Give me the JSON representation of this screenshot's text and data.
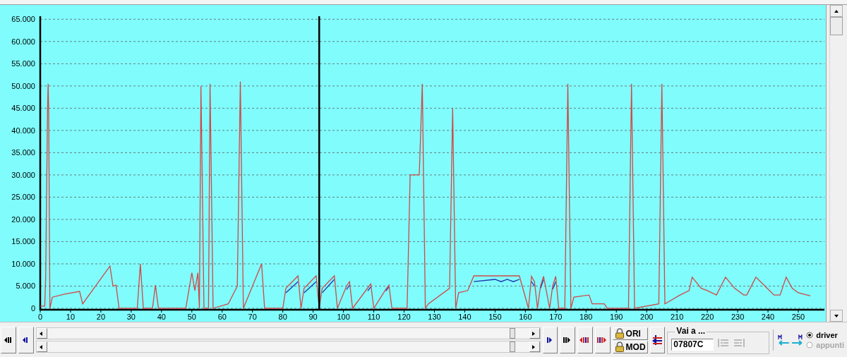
{
  "chart": {
    "chart_data": {
      "type": "line",
      "x": [
        0,
        1.5,
        1.8,
        2,
        2.2,
        2.4,
        2.6,
        2.8,
        3,
        3.2,
        4,
        8,
        13,
        14,
        23,
        24,
        25,
        26,
        32,
        33,
        34,
        37,
        38,
        39,
        48,
        49,
        50,
        51,
        52,
        52.5,
        53,
        54,
        55.5,
        56,
        57,
        62,
        65,
        66,
        67,
        70,
        73,
        74,
        80,
        81,
        85,
        86,
        87,
        91,
        92,
        93,
        97,
        98,
        101,
        102,
        103,
        108,
        109,
        110,
        114,
        115,
        116,
        121,
        122,
        125,
        126,
        127,
        128,
        135,
        136,
        137,
        138,
        141,
        143,
        150,
        152,
        154,
        156,
        158,
        161,
        162,
        163,
        164,
        165,
        166,
        168,
        169,
        170,
        171,
        173,
        174,
        175,
        176,
        181,
        182,
        186,
        187,
        194,
        195,
        196,
        204,
        205,
        206,
        211,
        214,
        215,
        218,
        220,
        223,
        226,
        229,
        232,
        233,
        236,
        239,
        242,
        244,
        246,
        248,
        250,
        254
      ],
      "series": [
        {
          "color": "#2030b0",
          "values": [
            null,
            null,
            null,
            null,
            null,
            null,
            null,
            null,
            null,
            null,
            null,
            null,
            null,
            null,
            null,
            null,
            null,
            null,
            null,
            null,
            null,
            null,
            null,
            null,
            null,
            null,
            null,
            null,
            null,
            null,
            null,
            null,
            null,
            null,
            null,
            null,
            null,
            null,
            null,
            null,
            null,
            null,
            null,
            3500,
            6000,
            null,
            3500,
            6000,
            null,
            3500,
            6500,
            null,
            4200,
            5200,
            null,
            3900,
            4800,
            null,
            3900,
            4800,
            null,
            null,
            null,
            null,
            null,
            null,
            null,
            null,
            null,
            null,
            null,
            null,
            6000,
            6500,
            6000,
            6500,
            6000,
            6500,
            null,
            6000,
            5000,
            null,
            4500,
            6500,
            null,
            4300,
            6000,
            null,
            null,
            null,
            null,
            null,
            null,
            null,
            null,
            null,
            null,
            null,
            null,
            null,
            null,
            null,
            null,
            null,
            null,
            null,
            null,
            null,
            null,
            null,
            null,
            null,
            null,
            null,
            null,
            null,
            null,
            null,
            null,
            null
          ]
        },
        {
          "color": "#d04848",
          "values": [
            500,
            500,
            7000,
            20000,
            32000,
            44000,
            50500,
            44000,
            20000,
            0,
            2500,
            3200,
            3800,
            1000,
            9500,
            5000,
            5200,
            0,
            0,
            10000,
            0,
            0,
            5200,
            0,
            0,
            4000,
            8000,
            4000,
            8000,
            0,
            50000,
            0,
            0,
            50500,
            0,
            1000,
            5000,
            51000,
            0,
            5000,
            10000,
            0,
            0,
            4500,
            7300,
            0,
            4500,
            7300,
            0,
            4500,
            7300,
            0,
            5000,
            6000,
            0,
            4600,
            5500,
            0,
            4300,
            5200,
            0,
            0,
            30000,
            30000,
            50500,
            0,
            1000,
            4500,
            45000,
            0,
            3500,
            4000,
            7300,
            7300,
            7300,
            7300,
            7300,
            7300,
            0,
            7200,
            6000,
            0,
            5000,
            7200,
            0,
            5000,
            7200,
            0,
            0,
            50500,
            0,
            2500,
            3000,
            1000,
            1000,
            0,
            0,
            50500,
            0,
            1000,
            50500,
            1000,
            3000,
            4000,
            7000,
            4500,
            4000,
            3000,
            7000,
            4500,
            3000,
            3000,
            7000,
            5000,
            3000,
            3000,
            7000,
            4500,
            3500,
            2800
          ]
        }
      ],
      "xlim": [
        0,
        259
      ],
      "ylim": [
        0,
        66000
      ],
      "grid": true,
      "xticks": [
        0,
        10,
        20,
        30,
        40,
        50,
        60,
        70,
        80,
        90,
        100,
        110,
        120,
        130,
        140,
        150,
        160,
        170,
        180,
        190,
        200,
        210,
        220,
        230,
        240,
        250
      ],
      "yticks": [
        {
          "value": 0,
          "label": "0"
        },
        {
          "value": 5000,
          "label": "5.000"
        },
        {
          "value": 10000,
          "label": "10.000"
        },
        {
          "value": 15000,
          "label": "15.000"
        },
        {
          "value": 20000,
          "label": "20.000"
        },
        {
          "value": 25000,
          "label": "25.000"
        },
        {
          "value": 30000,
          "label": "30.000"
        },
        {
          "value": 35000,
          "label": "35.000"
        },
        {
          "value": 40000,
          "label": "40.000"
        },
        {
          "value": 45000,
          "label": "45.000"
        },
        {
          "value": 50000,
          "label": "50.000"
        },
        {
          "value": 55000,
          "label": "55.000"
        },
        {
          "value": 60000,
          "label": "60.000"
        },
        {
          "value": 65000,
          "label": "65.000"
        }
      ],
      "ref_lines": [
        {
          "axis": "x",
          "value": 92,
          "color": "#000000"
        }
      ]
    }
  },
  "toolbar": {
    "lock_buttons": [
      {
        "label": "ORI"
      },
      {
        "label": "MOD"
      }
    ],
    "goto": {
      "title": "Vai a ...",
      "value": "07807C"
    },
    "sources": [
      {
        "label": "driver",
        "selected": true,
        "disabled": false
      },
      {
        "label": "appunti",
        "selected": false,
        "disabled": true
      }
    ]
  }
}
